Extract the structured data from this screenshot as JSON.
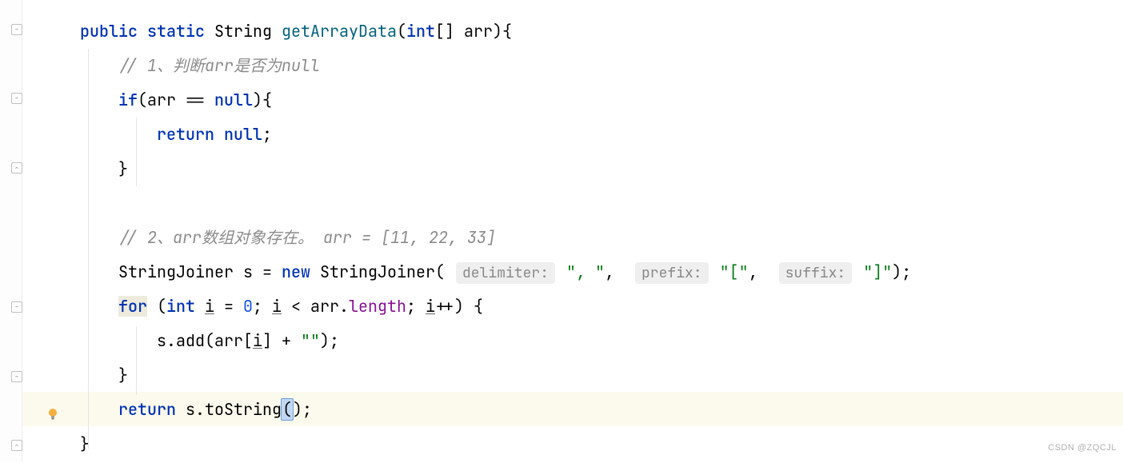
{
  "watermark": "CSDN @ZQCJL",
  "code": {
    "l1_public": "public",
    "l1_static": "static",
    "l1_type": "String",
    "l1_method": "getArrayData",
    "l1_param_type": "int",
    "l1_param_brackets": "[]",
    "l1_param_name": "arr",
    "l2_comment": "// 1、判断arr是否为null",
    "l3_if": "if",
    "l3_cond_lhs": "arr",
    "l3_cond_op": "==",
    "l3_null": "null",
    "l4_return": "return",
    "l4_null": "null",
    "l5_close": "}",
    "l7_comment": "// 2、arr数组对象存在。 arr = [11, 22, 33]",
    "l8_type": "StringJoiner",
    "l8_var": "s",
    "l8_new": "new",
    "l8_ctor": "StringJoiner",
    "l8_hint1": "delimiter:",
    "l8_arg1": "\", \"",
    "l8_hint2": "prefix:",
    "l8_arg2": "\"[\"",
    "l8_hint3": "suffix:",
    "l8_arg3": "\"]\"",
    "l9_for": "for",
    "l9_int": "int",
    "l9_i": "i",
    "l9_eq": "=",
    "l9_zero": "0",
    "l9_lt": "<",
    "l9_arr": "arr",
    "l9_len": "length",
    "l9_inc": "++",
    "l10_s": "s",
    "l10_add": "add",
    "l10_arr": "arr",
    "l10_i": "i",
    "l10_plus": "+",
    "l10_empty": "\"\"",
    "l11_close": "}",
    "l12_return": "return",
    "l12_s": "s",
    "l12_toString": "toString",
    "l13_close": "}"
  }
}
